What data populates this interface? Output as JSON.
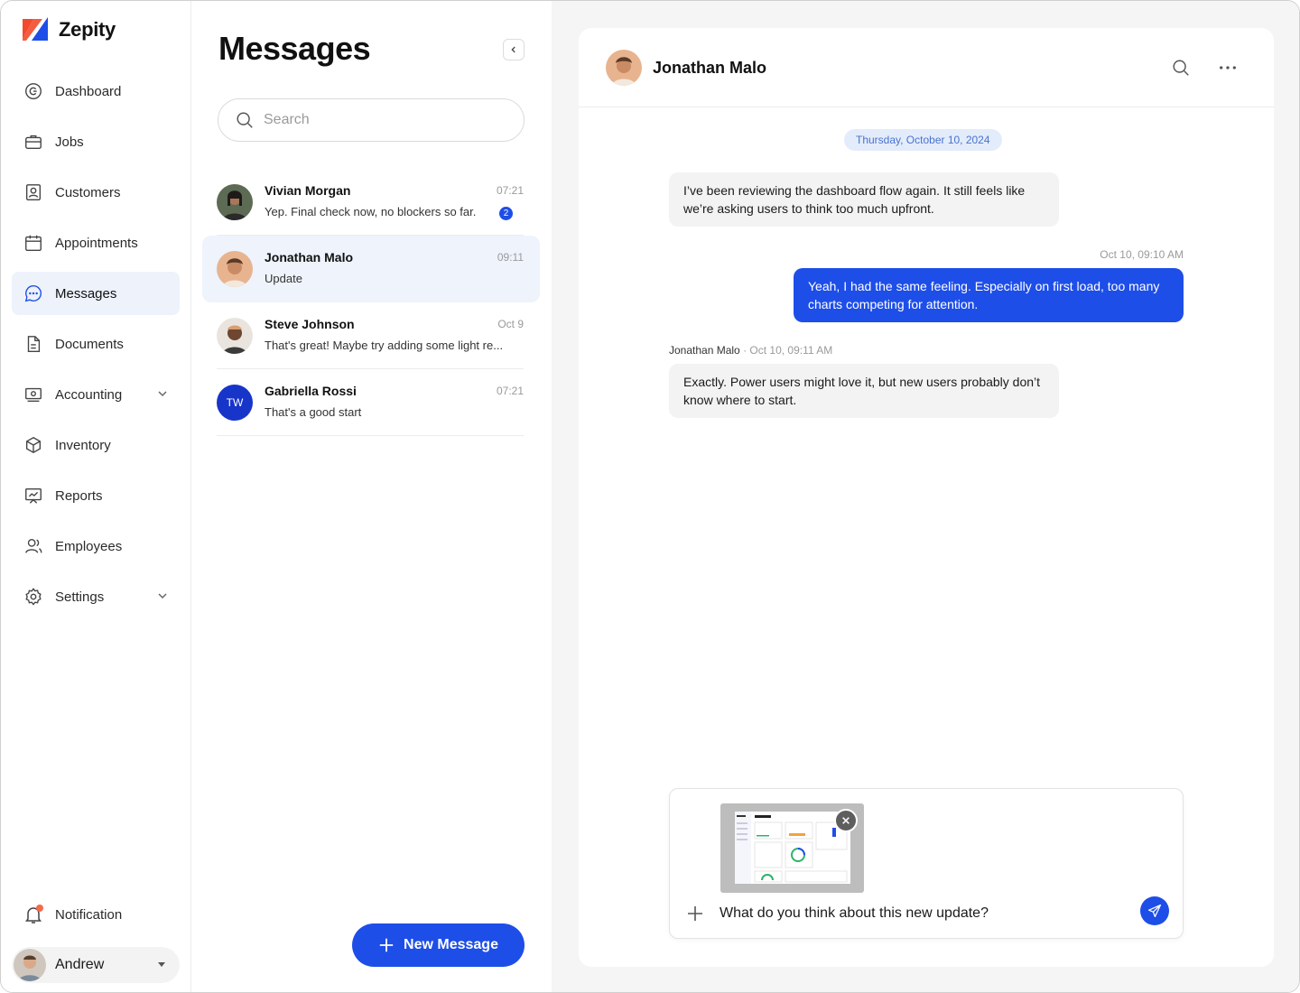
{
  "app": {
    "name": "Zepity"
  },
  "sidebar": {
    "items": [
      {
        "label": "Dashboard",
        "icon": "dashboard-icon"
      },
      {
        "label": "Jobs",
        "icon": "briefcase-icon"
      },
      {
        "label": "Customers",
        "icon": "customer-icon"
      },
      {
        "label": "Appointments",
        "icon": "calendar-icon"
      },
      {
        "label": "Messages",
        "icon": "chat-icon",
        "active": true
      },
      {
        "label": "Documents",
        "icon": "document-icon"
      },
      {
        "label": "Accounting",
        "icon": "accounting-icon",
        "expandable": true
      },
      {
        "label": "Inventory",
        "icon": "box-icon"
      },
      {
        "label": "Reports",
        "icon": "report-icon"
      },
      {
        "label": "Employees",
        "icon": "users-icon"
      },
      {
        "label": "Settings",
        "icon": "gear-icon",
        "expandable": true
      }
    ],
    "notification": {
      "label": "Notification",
      "has_unread": true
    },
    "user": {
      "name": "Andrew"
    }
  },
  "messages_list": {
    "title": "Messages",
    "search_placeholder": "Search",
    "conversations": [
      {
        "name": "Vivian Morgan",
        "time": "07:21",
        "preview": "Yep. Final check now, no blockers so far.",
        "unread": "2"
      },
      {
        "name": "Jonathan Malo",
        "time": "09:11",
        "preview": "Update",
        "active": true
      },
      {
        "name": "Steve Johnson",
        "time": "Oct 9",
        "preview": "That's great! Maybe try adding some light re..."
      },
      {
        "name": "Gabriella Rossi",
        "time": "07:21",
        "preview": "That's a good start",
        "initials": "TW"
      }
    ],
    "new_message_label": "New Message"
  },
  "chat": {
    "contact_name": "Jonathan Malo",
    "date_divider": "Thursday, October 10, 2024",
    "messages": [
      {
        "direction": "in",
        "text": "I’ve been reviewing the dashboard flow again. It still feels like we’re asking users to think too much upfront."
      },
      {
        "direction": "out",
        "meta": "Oct 10, 09:10 AM",
        "text": "Yeah, I had the same feeling. Especially on first load, too many charts competing for attention."
      },
      {
        "direction": "in",
        "sender": "Jonathan Malo",
        "meta": "· Oct 10, 09:11 AM",
        "text": "Exactly. Power users might love it, but new users probably don’t know where to start."
      }
    ],
    "composer": {
      "value": "What do you think about this new update?"
    }
  },
  "colors": {
    "accent": "#1e4ee8",
    "active_bg": "#edf2fb",
    "logo_red": "#f24a2c",
    "logo_blue": "#1e4ee8"
  }
}
